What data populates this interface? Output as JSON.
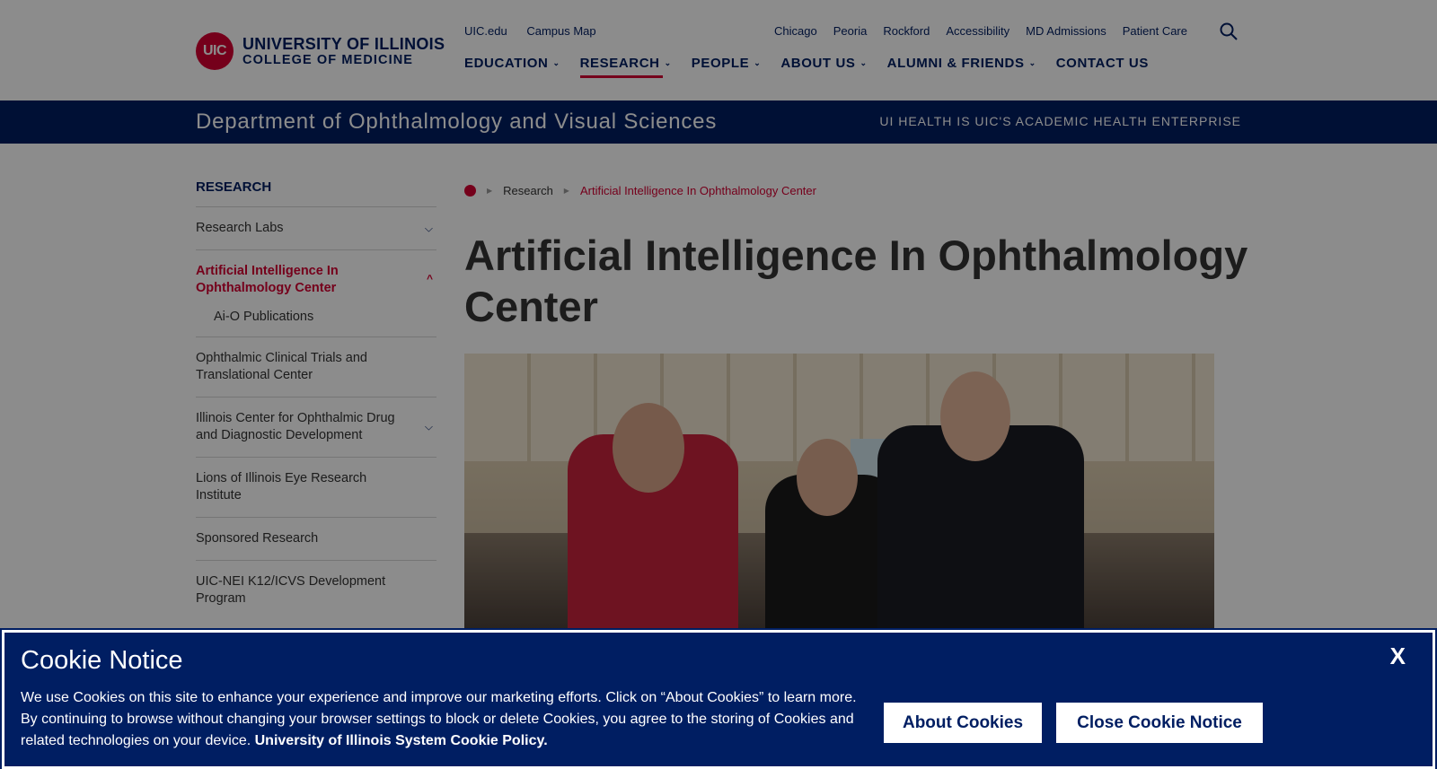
{
  "header": {
    "logo_mark": "UIC",
    "logo_line1": "UNIVERSITY OF ILLINOIS",
    "logo_line2": "COLLEGE OF MEDICINE",
    "utility_left": [
      "UIC.edu",
      "Campus Map"
    ],
    "utility_right": [
      "Chicago",
      "Peoria",
      "Rockford",
      "Accessibility",
      "MD Admissions",
      "Patient Care"
    ],
    "nav": [
      {
        "label": "EDUCATION",
        "has_menu": true,
        "active": false
      },
      {
        "label": "RESEARCH",
        "has_menu": true,
        "active": true
      },
      {
        "label": "PEOPLE",
        "has_menu": true,
        "active": false
      },
      {
        "label": "ABOUT US",
        "has_menu": true,
        "active": false
      },
      {
        "label": "ALUMNI & FRIENDS",
        "has_menu": true,
        "active": false
      },
      {
        "label": "CONTACT US",
        "has_menu": false,
        "active": false
      }
    ]
  },
  "department": {
    "title": "Department of Ophthalmology and Visual Sciences",
    "tagline": "UI HEALTH IS UIC'S ACADEMIC HEALTH ENTERPRISE"
  },
  "sidebar": {
    "heading": "RESEARCH",
    "items": [
      {
        "label": "Research Labs",
        "icon": "chevron-down-icon"
      },
      {
        "label": "Artificial Intelligence In Ophthalmology Center",
        "icon": "chevron-up-icon",
        "active": true
      },
      {
        "label": "Ai-O Publications",
        "sub": true
      },
      {
        "label": "Ophthalmic Clinical Trials and Translational Center"
      },
      {
        "label": "Illinois Center for Ophthalmic Drug and Diagnostic Development",
        "icon": "chevron-down-icon"
      },
      {
        "label": "Lions of Illinois Eye Research Institute"
      },
      {
        "label": "Sponsored Research"
      },
      {
        "label": "UIC-NEI K12/ICVS Development Program"
      }
    ]
  },
  "breadcrumb": {
    "items": [
      "Research",
      "Artificial Intelligence In Ophthalmology Center"
    ]
  },
  "main": {
    "title": "Artificial Intelligence In Ophthalmology Center"
  },
  "cookie": {
    "title": "Cookie Notice",
    "close_label": "X",
    "text": "We use Cookies on this site to enhance your experience and improve our marketing efforts. Click on “About Cookies” to learn more. By continuing to browse without changing your browser settings to block or delete Cookies, you agree to the storing of Cookies and related technologies on your device.",
    "policy_link": "University of Illinois System Cookie Policy.",
    "about_button": "About Cookies",
    "close_button": "Close Cookie Notice"
  },
  "colors": {
    "brand_navy": "#001e62",
    "brand_red": "#d50032"
  }
}
